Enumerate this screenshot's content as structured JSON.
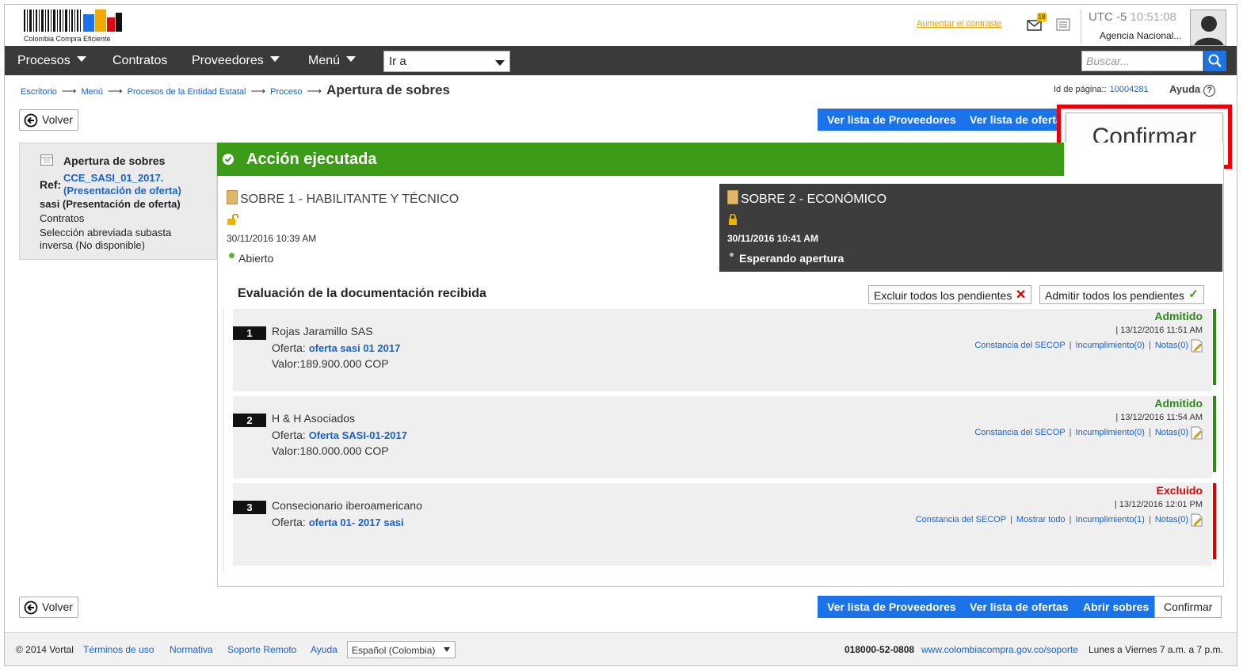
{
  "header": {
    "logo_text": "Colombia Compra Eficiente",
    "contrast_link": "Aumentar el contraste",
    "mail_badge": "18",
    "utc_label": "UTC -5",
    "clock": "10:51:08",
    "agency": "Agencia Nacional..."
  },
  "nav": {
    "items": [
      {
        "label": "Procesos"
      },
      {
        "label": "Contratos"
      },
      {
        "label": "Proveedores"
      },
      {
        "label": "Menú"
      }
    ],
    "goto_value": "Ir a",
    "search_placeholder": "Buscar..."
  },
  "breadcrumb": {
    "items": [
      "Escritorio",
      "Menú",
      "Procesos de la Entidad Estatal",
      "Proceso"
    ],
    "current": "Apertura de sobres"
  },
  "page_meta": {
    "page_id_label": "Id de página::",
    "page_id": "10004281",
    "help": "Ayuda",
    "help_symbol": "?"
  },
  "actions": {
    "back": "Volver",
    "suppliers": "Ver lista de Proveedores",
    "offers": "Ver lista de ofertas",
    "open": "Abrir sobres",
    "confirm": "Confirmar",
    "confirm_big": "Confirmar"
  },
  "left_panel": {
    "title": "Apertura de sobres",
    "ref_label": "Ref:",
    "ref_line1": "CCE_SASI_01_2017.",
    "ref_line2": "(Presentación de oferta)",
    "subtitle": "sasi (Presentación de oferta)",
    "type": "Contratos",
    "modality_line1": "Selección abreviada subasta",
    "modality_line2": "inversa (No disponible)"
  },
  "banner": {
    "title": "Acción ejecutada",
    "color": "#3c9b17"
  },
  "envelopes": [
    {
      "title": "SOBRE 1 - HABILITANTE Y TÉCNICO",
      "date": "30/11/2016 10:39 AM",
      "status": "Abierto"
    },
    {
      "title": "SOBRE 2 - ECONÓMICO",
      "date": "30/11/2016 10:41 AM",
      "status": "Esperando apertura"
    }
  ],
  "evaluation": {
    "title": "Evaluación de la documentación recibida",
    "exclude_all": "Excluir todos los pendientes",
    "admit_all": "Admitir todos los pendientes"
  },
  "offers": [
    {
      "num": "1",
      "name": "Rojas Jaramillo SAS",
      "oferta_label": "Oferta:",
      "oferta_link": "oferta sasi 01 2017",
      "valor": "Valor:189.900.000 COP",
      "status": "Admitido",
      "status_color": "#2d8a1a",
      "date": "| 13/12/2016 11:51 AM",
      "links": [
        "Constancia del SECOP",
        "Incumplimiento(0)",
        "Notas(0)"
      ]
    },
    {
      "num": "2",
      "name": "H & H Asociados",
      "oferta_label": "Oferta:",
      "oferta_link": "Oferta SASI-01-2017",
      "valor": "Valor:180.000.000 COP",
      "status": "Admitido",
      "status_color": "#2d8a1a",
      "date": "| 13/12/2016 11:54 AM",
      "links": [
        "Constancia del SECOP",
        "Incumplimiento(0)",
        "Notas(0)"
      ]
    },
    {
      "num": "3",
      "name": "Consecionario iberoamericano",
      "oferta_label": "Oferta:",
      "oferta_link": "oferta 01- 2017 sasi",
      "valor": "",
      "status": "Excluido",
      "status_color": "#e00000",
      "date": "| 13/12/2016 12:01 PM",
      "links": [
        "Constancia del SECOP",
        "Mostrar todo",
        "Incumplimiento(1)",
        "Notas(0)"
      ]
    }
  ],
  "footer": {
    "copyright": "© 2014 Vortal",
    "links": [
      "Términos de uso",
      "Normativa",
      "Soporte Remoto",
      "Ayuda"
    ],
    "language": "Español (Colombia)",
    "phone": "018000-52-0808",
    "support_url": "www.colombiacompra.gov.co/soporte",
    "hours": "Lunes a Viernes 7 a.m. a 7 p.m."
  }
}
